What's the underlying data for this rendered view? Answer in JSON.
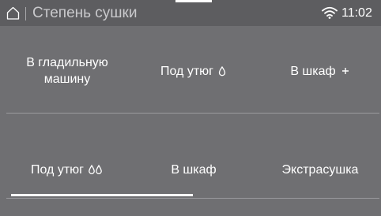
{
  "header": {
    "title": "Степень сушки",
    "time": "11:02",
    "icons": {
      "home": "home-icon",
      "wifi": "wifi-icon"
    }
  },
  "options": [
    {
      "label": "В гладильную машину",
      "icon": null
    },
    {
      "label": "Под утюг",
      "icon": "single-drop-icon"
    },
    {
      "label": "В шкаф",
      "icon": "plus-icon"
    },
    {
      "label": "Под утюг",
      "icon": "double-drop-icon"
    },
    {
      "label": "В шкаф",
      "icon": null
    },
    {
      "label": "Экстрасушка",
      "icon": null
    }
  ],
  "scroll": {
    "page": 1,
    "pages": 2
  }
}
